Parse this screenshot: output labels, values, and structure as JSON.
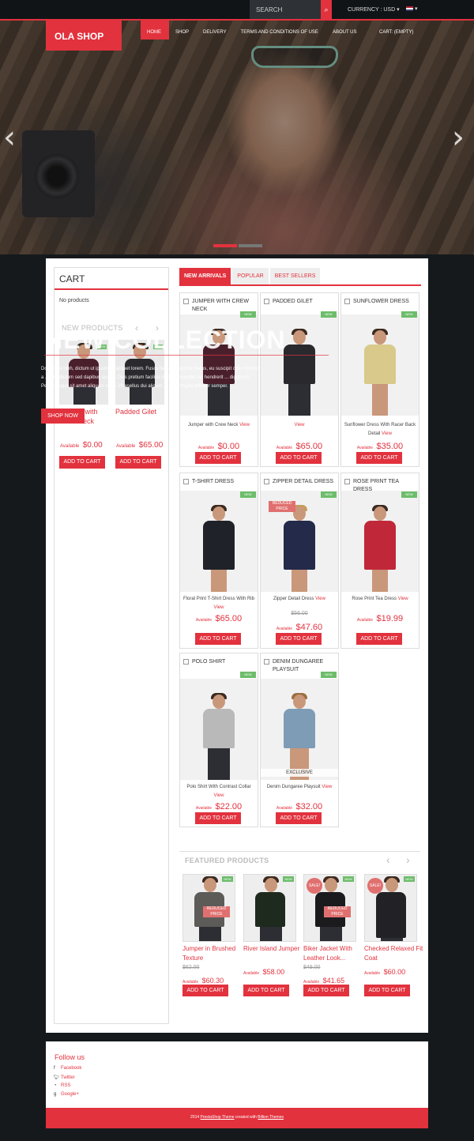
{
  "topbar": {
    "search_placeholder": "SEARCH",
    "search_icon": "magnifier-icon",
    "currency": "CURRENCY : USD",
    "currency_caret": "▾",
    "language_caret": "▾"
  },
  "header": {
    "logo": "OLA SHOP",
    "nav": [
      "HOME",
      "SHOP",
      "DELIVERY",
      "TERMS AND CONDITIONS OF USE",
      "ABOUT US"
    ],
    "cart": "CART: (EMPTY)"
  },
  "hero": {
    "prev": "‹",
    "next": "›",
    "slides": 2,
    "active_slide": 1
  },
  "sidebar": {
    "cart_title": "CART",
    "no_products": "No products",
    "new_products_title": "NEW PRODUCTS",
    "prev": "‹",
    "next": "›",
    "items": [
      {
        "name": "Jumper with Crew Neck",
        "avail": "Available",
        "price": "$0.00",
        "button": "ADD TO CART"
      },
      {
        "name": "Padded Gilet",
        "avail": "Available",
        "price": "$65.00",
        "button": "ADD TO CART"
      }
    ]
  },
  "overlay": {
    "title": "NEW COLLECTION",
    "text": "Donec vel nibh, dictum ut ipsum in, aliquet lorem. Fusce faucibus lacinia metus, eu suscipit odio rhoncus a ... Vestibulum sed dapibus augue. Duis pretium facilisis turpis, imperdiet vel hendrerit ... dignissim. Pellentesque sit amet aliquam nunc. Phasellus dui aliquet ... Sed fringilla efficitur semper.",
    "button": "SHOP NOW"
  },
  "tabs": [
    "NEW ARRIVALS",
    "POPULAR",
    "BEST SELLERS"
  ],
  "new_tag": "NEW",
  "reduced_tag": "REDUCED PRICE",
  "products": [
    {
      "name": "JUMPER WITH CREW NECK",
      "desc": "Jumper with Crew Neck",
      "view": "View",
      "old": "",
      "avail": "Available",
      "price": "$0.00",
      "button": "ADD TO CART",
      "color": "#4a1f2c"
    },
    {
      "name": "PADDED GILET",
      "desc": "",
      "view": "View",
      "old": "",
      "avail": "Available",
      "price": "$65.00",
      "button": "ADD TO CART",
      "color": "#2a2a2e"
    },
    {
      "name": "SUNFLOWER DRESS",
      "desc": "Sunflower Dress With Racer Back Detail",
      "view": "View",
      "old": "",
      "avail": "Available",
      "price": "$35.00",
      "button": "ADD TO CART",
      "color": "#d9c98a"
    },
    {
      "name": "T-SHIRT DRESS",
      "desc": "Floral Print T-Shirt Dress With Rib",
      "view": "View",
      "old": "",
      "avail": "Available",
      "price": "$65.00",
      "button": "ADD TO CART",
      "color": "#1f2228"
    },
    {
      "name": "ZIPPER DETAIL DRESS",
      "desc": "Zipper Detail Dress",
      "view": "View",
      "old": "$56.00",
      "avail": "Available",
      "price": "$47.60",
      "button": "ADD TO CART",
      "color": "#232a4a"
    },
    {
      "name": "ROSE PRINT TEA DRESS",
      "desc": "Rose Print Tea Dress",
      "view": "View",
      "old": "",
      "avail": "Available",
      "price": "$19.99",
      "button": "ADD TO CART",
      "color": "#c0283a"
    },
    {
      "name": "POLO SHIRT",
      "desc": "Polo Shirt With Contrast Collar",
      "view": "View",
      "old": "",
      "avail": "Available",
      "price": "$22.00",
      "button": "ADD TO CART",
      "color": "#b9b9b9"
    },
    {
      "name": "DENIM DUNGAREE PLAYSUIT",
      "desc": "Denim Dungaree Playsuit",
      "view": "View",
      "old": "",
      "avail": "Available",
      "price": "$32.00",
      "button": "ADD TO CART",
      "color": "#7e9cb6"
    }
  ],
  "exclusive_tag": "EXCLUSIVE",
  "featured": {
    "title": "FEATURED PRODUCTS",
    "prev": "‹",
    "next": "›",
    "sale_tag": "SALE!",
    "items": [
      {
        "name": "Jumper in Brushed Texture",
        "old": "$62.00",
        "avail": "Available",
        "price": "$60.30",
        "button": "ADD TO CART",
        "color": "#5d5b58"
      },
      {
        "name": "River Island Jumper",
        "old": "",
        "avail": "Available",
        "price": "$58.00",
        "button": "ADD TO CART",
        "color": "#1f2a1f"
      },
      {
        "name": "Biker Jacket With Leather Look...",
        "old": "$49.00",
        "avail": "Available",
        "price": "$41.65",
        "button": "ADD TO CART",
        "color": "#1b1b1e"
      },
      {
        "name": "Checked Relaxed Fit Coat",
        "old": "",
        "avail": "Available",
        "price": "$60.00",
        "button": "ADD TO CART",
        "color": "#222226"
      }
    ]
  },
  "footer": {
    "follow": "Follow us",
    "links": [
      "Facebook",
      "Twitter",
      "RSS",
      "Google+"
    ],
    "copyright_prefix": "2014 ",
    "copyright_link1": "PrestaShop Theme",
    "copyright_mid": " created with ",
    "copyright_link2": "Billion Themes"
  }
}
